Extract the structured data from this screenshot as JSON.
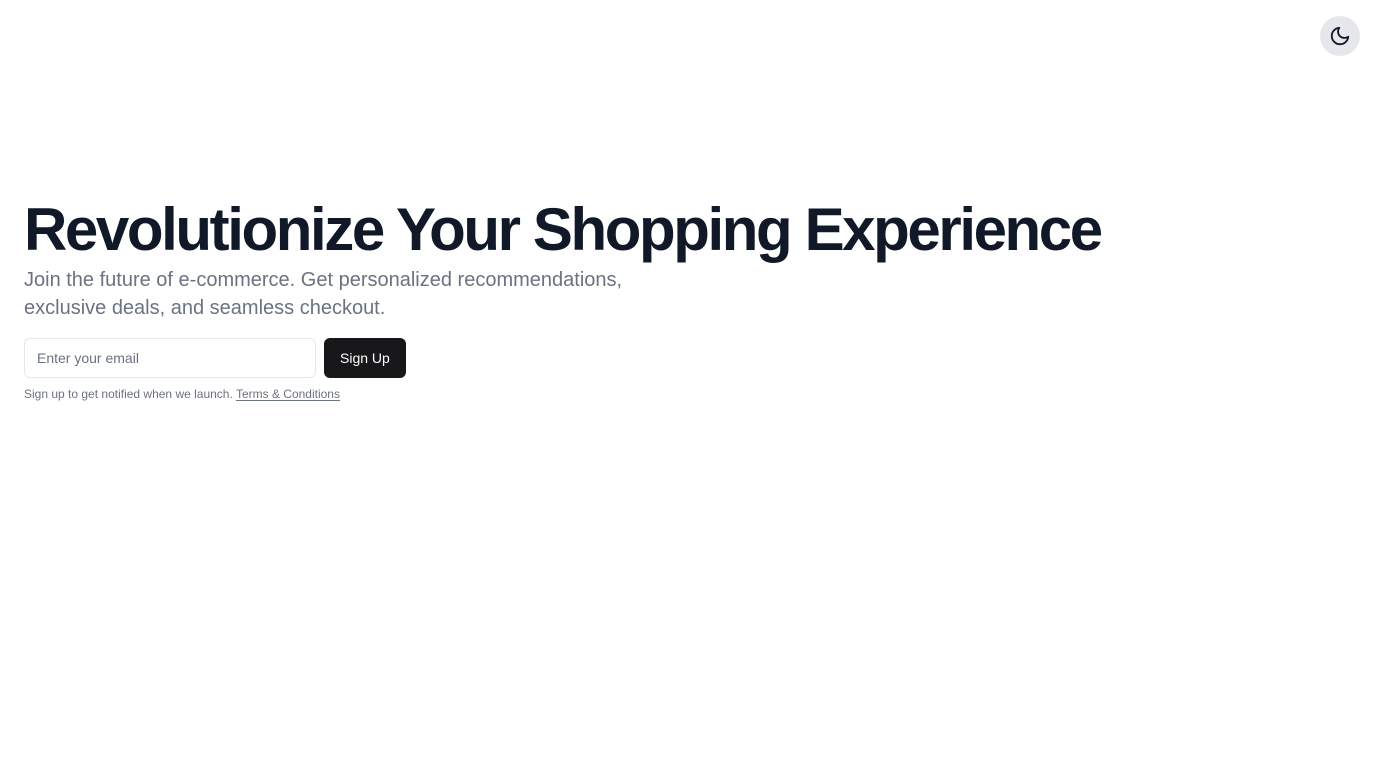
{
  "header": {
    "theme_toggle_icon": "moon-icon"
  },
  "hero": {
    "title": "Revolutionize Your Shopping Experience",
    "subtitle": "Join the future of e-commerce. Get personalized recommendations, exclusive deals, and seamless checkout."
  },
  "signup": {
    "email_placeholder": "Enter your email",
    "email_value": "",
    "button_label": "Sign Up",
    "note_text": "Sign up to get notified when we launch.",
    "terms_link_label": "Terms & Conditions"
  },
  "colors": {
    "title": "#111827",
    "muted_text": "#6b7280",
    "button_bg": "#18181b",
    "toggle_bg": "#e5e7eb"
  }
}
